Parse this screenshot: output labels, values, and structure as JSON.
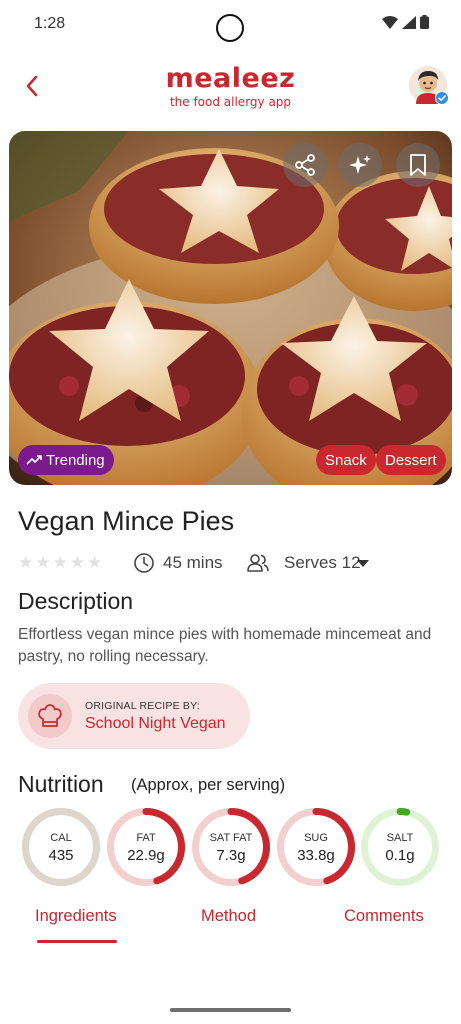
{
  "status_bar": {
    "time": "1:28"
  },
  "header": {
    "logo_text": "mealeez",
    "logo_tagline": "the food allergy app"
  },
  "hero": {
    "actions": [
      "share-icon",
      "sparkle-icon",
      "bookmark-icon"
    ],
    "trending_label": "Trending",
    "tags": [
      "Snack",
      "Dessert"
    ]
  },
  "recipe": {
    "title": "Vegan Mince Pies",
    "rating": 0,
    "time": "45 mins",
    "serves": "Serves 12"
  },
  "description": {
    "heading": "Description",
    "text": "Effortless vegan mince pies with homemade mincemeat and pastry, no rolling necessary."
  },
  "original_recipe": {
    "label": "ORIGINAL RECIPE BY:",
    "author": "School Night Vegan"
  },
  "nutrition": {
    "heading": "Nutrition",
    "subheading": "(Approx, per serving)",
    "items": [
      {
        "label": "CAL",
        "value": "435",
        "level": 1.0,
        "color": "#dcd6cc",
        "track": "#dcd6cc"
      },
      {
        "label": "FAT",
        "value": "22.9g",
        "level": 0.45,
        "color": "#c8282e",
        "track": "#f4cfcf"
      },
      {
        "label": "SAT FAT",
        "value": "7.3g",
        "level": 0.45,
        "color": "#c8282e",
        "track": "#f4cfcf"
      },
      {
        "label": "SUG",
        "value": "33.8g",
        "level": 0.45,
        "color": "#c8282e",
        "track": "#f4cfcf"
      },
      {
        "label": "SALT",
        "value": "0.1g",
        "level": 0.03,
        "color": "#43a820",
        "track": "#e0f2d5"
      }
    ]
  },
  "tabs": [
    "Ingredients",
    "Method",
    "Comments"
  ],
  "active_tab": "Ingredients",
  "colors": {
    "brand": "#c8282e",
    "trending": "#7a1a8c"
  }
}
